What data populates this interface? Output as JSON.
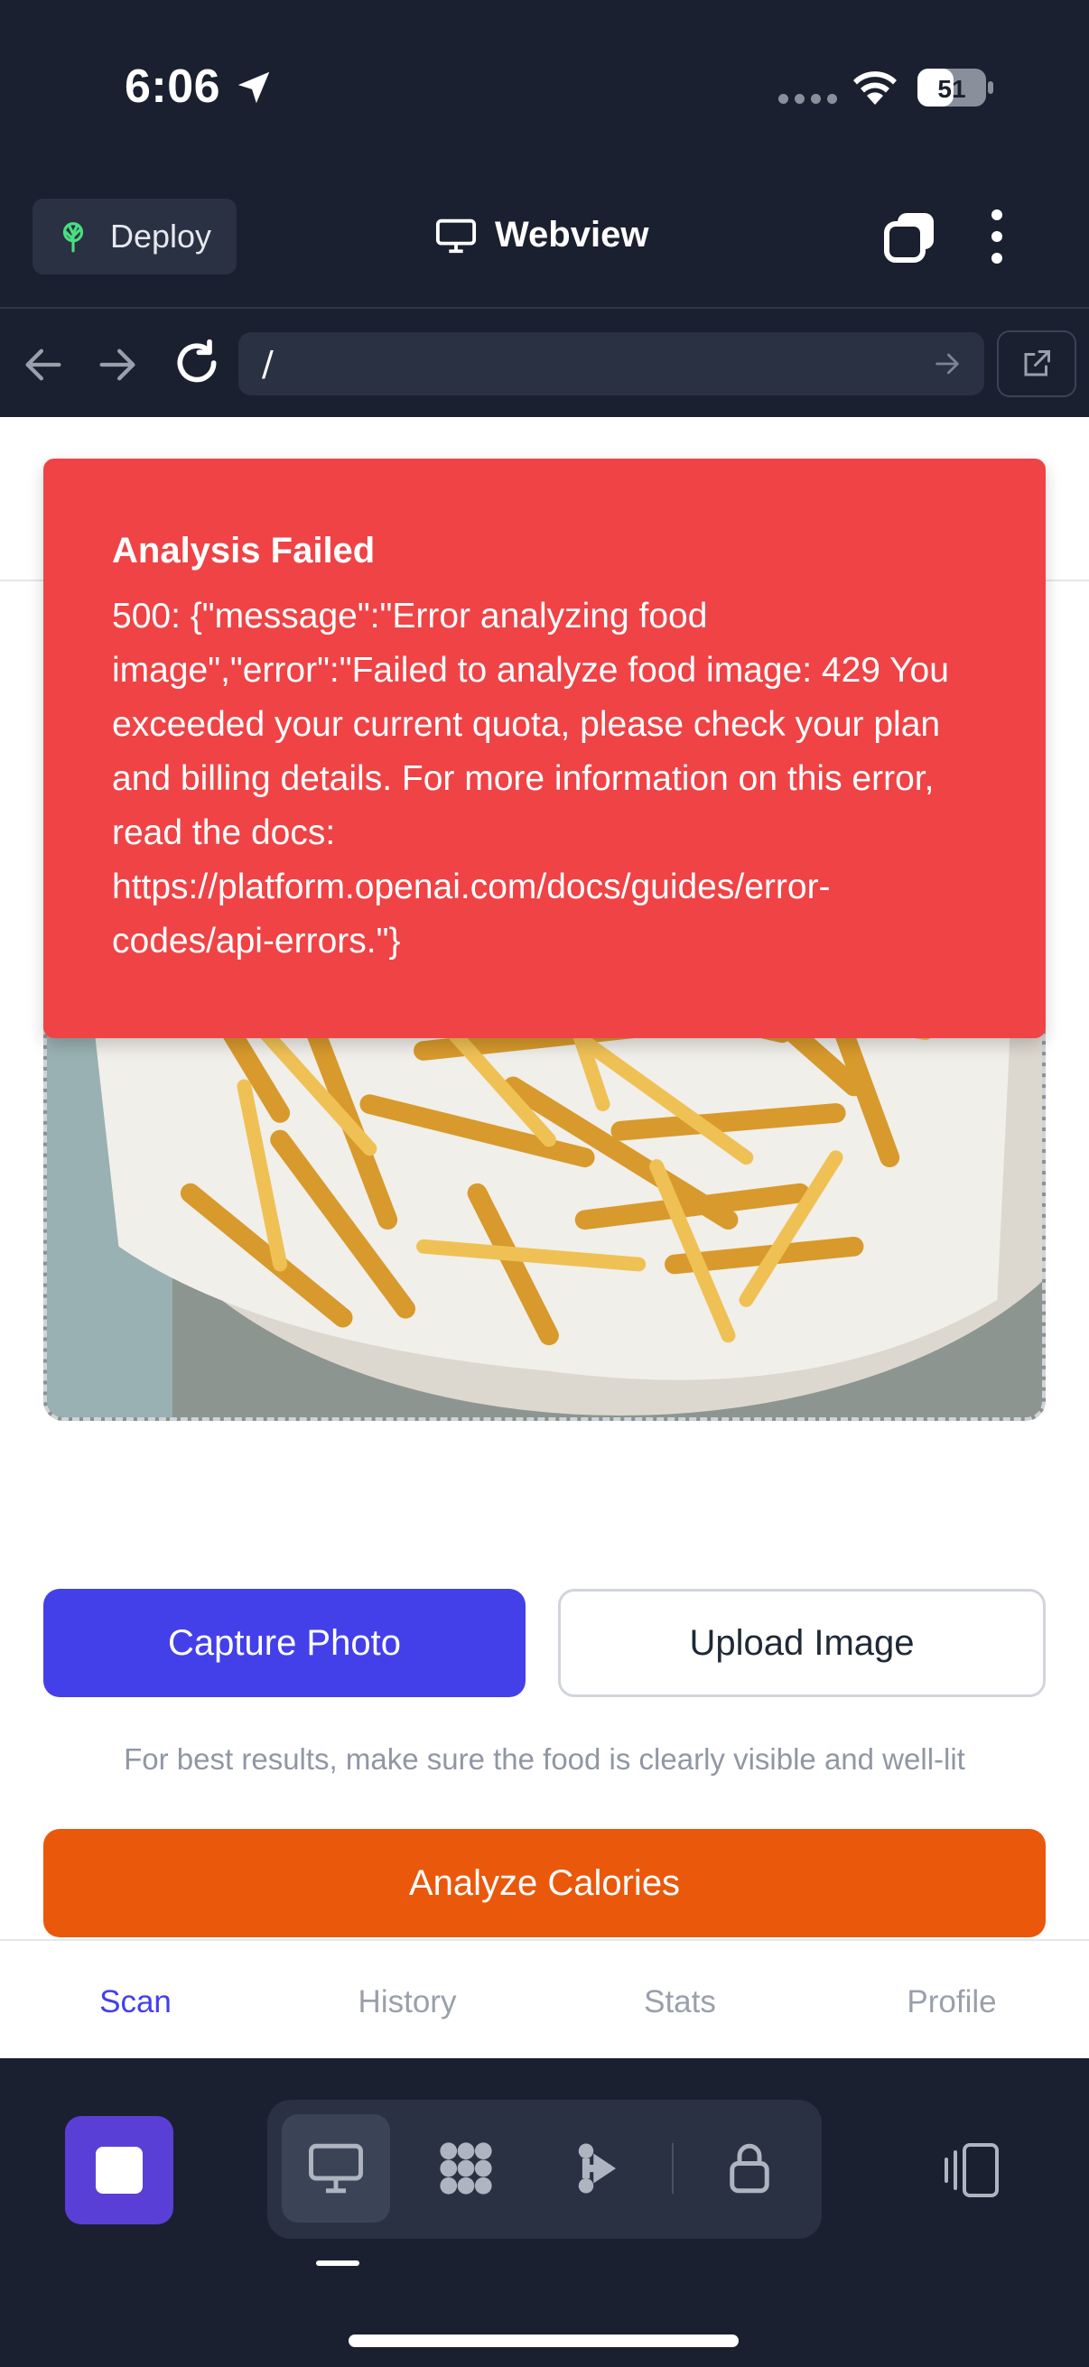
{
  "status_bar": {
    "time": "6:06",
    "battery": "51"
  },
  "app_header": {
    "deploy_label": "Deploy",
    "title": "Webview"
  },
  "url_bar": {
    "value": "/"
  },
  "error": {
    "title": "Analysis Failed",
    "message": "500: {\"message\":\"Error analyzing food image\",\"error\":\"Failed to analyze food image: 429 You exceeded your current quota, please check your plan and billing details. For more information on this error, read the docs: https://platform.openai.com/docs/guides/error-codes/api-errors.\"}"
  },
  "actions": {
    "capture_label": "Capture Photo",
    "upload_label": "Upload Image",
    "hint": "For best results, make sure the food is clearly visible and well-lit",
    "analyze_label": "Analyze Calories"
  },
  "bottom_nav": {
    "items": [
      {
        "label": "Scan",
        "active": true
      },
      {
        "label": "History",
        "active": false
      },
      {
        "label": "Stats",
        "active": false
      },
      {
        "label": "Profile",
        "active": false
      }
    ]
  },
  "colors": {
    "primary": "#4340ea",
    "accent": "#ea580c",
    "error": "#ef4346",
    "chrome_bg": "#1b2030"
  }
}
